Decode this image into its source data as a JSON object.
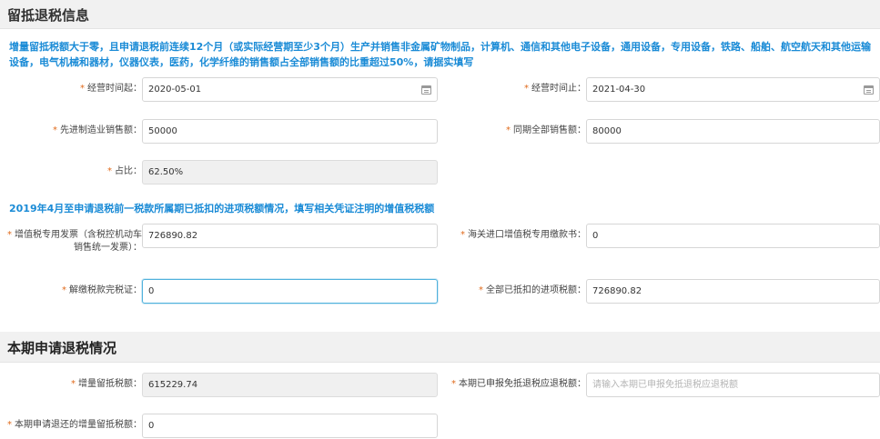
{
  "section1": {
    "title": "留抵退税信息",
    "notice": "增量留抵税额大于零，且申请退税前连续12个月（或实际经营期至少3个月）生产并销售非金属矿物制品，计算机、通信和其他电子设备，通用设备，专用设备，铁路、船舶、航空航天和其他运输设备，电气机械和器材，仪器仪表，医药，化学纤维的销售额占全部销售额的比重超过50%，请据实填写",
    "fields": {
      "start_date": {
        "label": "经营时间起：",
        "value": "2020-05-01"
      },
      "end_date": {
        "label": "经营时间止：",
        "value": "2021-04-30"
      },
      "adv_mfg_sales": {
        "label": "先进制造业销售额：",
        "value": "50000"
      },
      "total_sales": {
        "label": "同期全部销售额：",
        "value": "80000"
      },
      "ratio": {
        "label": "占比：",
        "value": "62.50%"
      }
    }
  },
  "section_input": {
    "notice": "2019年4月至申请退税前一税款所属期已抵扣的进项税额情况，填写相关凭证注明的增值税税额",
    "fields": {
      "vat_invoice": {
        "label": "增值税专用发票（含税控机动车销售统一发票）：",
        "value": "726890.82"
      },
      "customs": {
        "label": "海关进口增值税专用缴款书：",
        "value": "0"
      },
      "tax_payment": {
        "label": "解缴税款完税证：",
        "value": "0"
      },
      "total_deducted": {
        "label": "全部已抵扣的进项税额：",
        "value": "726890.82"
      }
    }
  },
  "section2": {
    "title": "本期申请退税情况",
    "fields": {
      "incremental": {
        "label": "增量留抵税额：",
        "value": "615229.74"
      },
      "declared": {
        "label": "本期已申报免抵退税应退税额：",
        "placeholder": "请输入本期已申报免抵退税应退税额"
      },
      "refund_amount": {
        "label": "本期申请退还的增量留抵税额：",
        "value": "0"
      }
    }
  },
  "colors": {
    "notice": "#1a8bd6",
    "required_star": "#e06a1b",
    "focus_border": "#4fb1dc"
  },
  "icons": {
    "date_picker": "calendar-icon"
  }
}
